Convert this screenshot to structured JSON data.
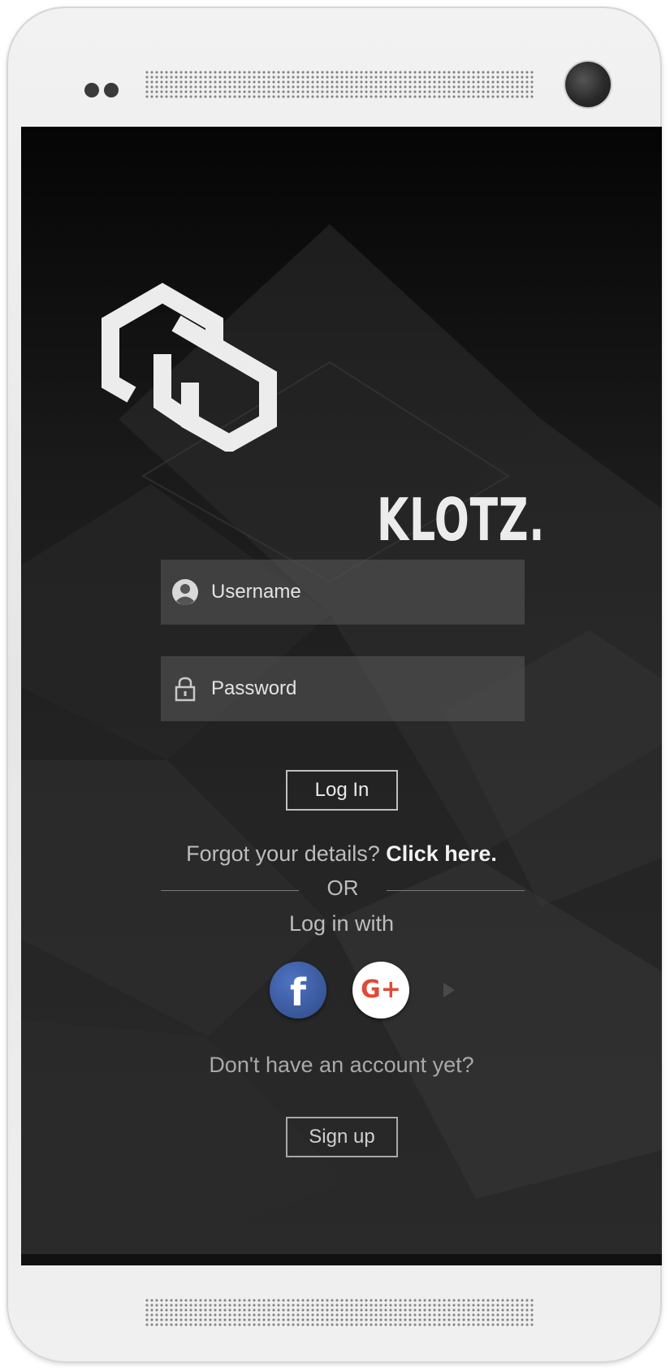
{
  "app": {
    "brand_name": "KLOTZ."
  },
  "login_form": {
    "username_placeholder": "Username",
    "password_placeholder": "Password",
    "login_label": "Log In"
  },
  "forgot": {
    "prompt": "Forgot your details? ",
    "link": "Click here."
  },
  "divider": {
    "or_label": "OR"
  },
  "social": {
    "heading": "Log in with",
    "facebook_glyph": "f",
    "google_plus_glyph": "G+"
  },
  "signup": {
    "prompt": "Don't have an account yet?",
    "button_label": "Sign up"
  },
  "icons": {
    "username": "user-circle-icon",
    "password": "lock-icon"
  },
  "colors": {
    "facebook_blue": "#3b5b9e",
    "google_red": "#dd4b39",
    "screen_background": "#1a1a1a"
  }
}
